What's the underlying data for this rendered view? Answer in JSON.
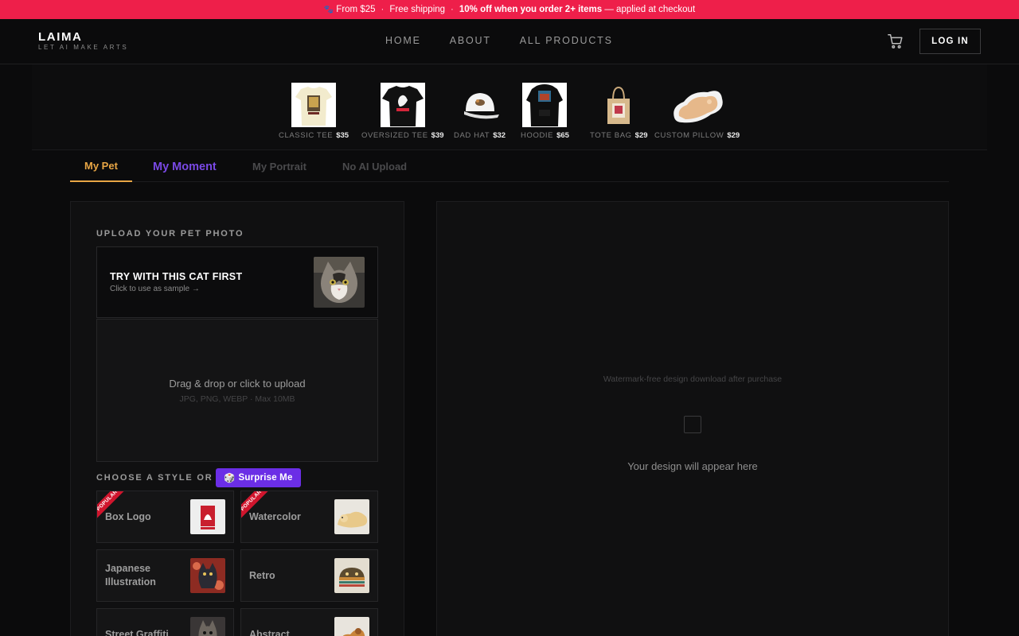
{
  "promo": {
    "paw_icon": "paw-icon",
    "from": "From $25",
    "shipping": "Free shipping",
    "discount": "10% off when you order 2+ items",
    "applied": "— applied at checkout"
  },
  "header": {
    "logo_title": "LAIMA",
    "logo_sub": "LET AI MAKE ARTS",
    "nav": [
      "HOME",
      "ABOUT",
      "ALL PRODUCTS"
    ],
    "cart_icon": "cart-icon",
    "login_label": "LOG IN"
  },
  "products": [
    {
      "name": "CLASSIC TEE",
      "price": "$35"
    },
    {
      "name": "OVERSIZED TEE",
      "price": "$39"
    },
    {
      "name": "DAD HAT",
      "price": "$32"
    },
    {
      "name": "HOODIE",
      "price": "$65"
    },
    {
      "name": "TOTE BAG",
      "price": "$29"
    },
    {
      "name": "CUSTOM PILLOW",
      "price": "$29"
    }
  ],
  "tabs": [
    "My Pet",
    "My Moment",
    "My Portrait",
    "No AI Upload"
  ],
  "upload": {
    "label": "UPLOAD YOUR PET PHOTO",
    "sample_title": "TRY WITH THIS CAT FIRST",
    "sample_sub": "Click to use as sample →",
    "drop_main": "Drag & drop or click to upload",
    "drop_sub": "JPG, PNG, WEBP · Max 10MB"
  },
  "style": {
    "label": "CHOOSE A STYLE OR",
    "surprise_icon": "🎲",
    "surprise_label": "Surprise Me",
    "ribbon": "POPULAR",
    "cards": [
      {
        "name": "Box Logo",
        "popular": true
      },
      {
        "name": "Watercolor",
        "popular": true
      },
      {
        "name": "Japanese Illustration",
        "popular": false
      },
      {
        "name": "Retro",
        "popular": false
      },
      {
        "name": "Street Graffiti",
        "popular": false
      },
      {
        "name": "Abstract",
        "popular": false
      }
    ]
  },
  "preview": {
    "watermark_note": "Watermark-free design download after purchase",
    "placeholder": "Your design will appear here"
  },
  "colors": {
    "promo": "#ee1f4a",
    "tab_active": "#e8a645",
    "tab_moment": "#7a49e6",
    "surprise": "#6b2ee6"
  }
}
